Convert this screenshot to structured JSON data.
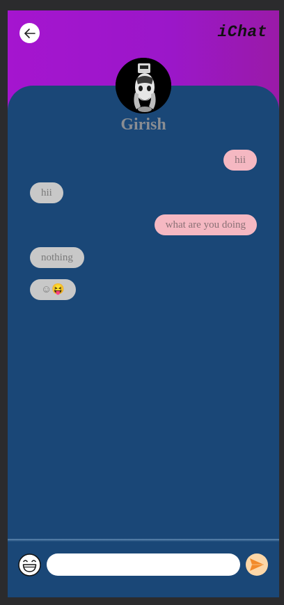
{
  "header": {
    "brand": "iChat",
    "back_icon": "arrow-left-icon"
  },
  "contact": {
    "name": "Girish",
    "avatar_icon": "avatar-photo"
  },
  "messages": [
    {
      "direction": "sent",
      "text": "hii"
    },
    {
      "direction": "received",
      "text": "hii"
    },
    {
      "direction": "sent",
      "text": "what are you doing"
    },
    {
      "direction": "received",
      "text": "nothing"
    },
    {
      "direction": "received",
      "text": "☺😝"
    }
  ],
  "composer": {
    "placeholder": "",
    "value": "",
    "emoji_icon": "smiley-icon",
    "send_icon": "send-icon"
  },
  "colors": {
    "header_gradient_start": "#a515cf",
    "header_gradient_end": "#9a1aa8",
    "chat_background": "#1a4777",
    "sent_bubble": "#f5b8c2",
    "received_bubble": "#c8c8c8",
    "send_button": "#fdd7a8",
    "send_arrow": "#f28a2a"
  }
}
